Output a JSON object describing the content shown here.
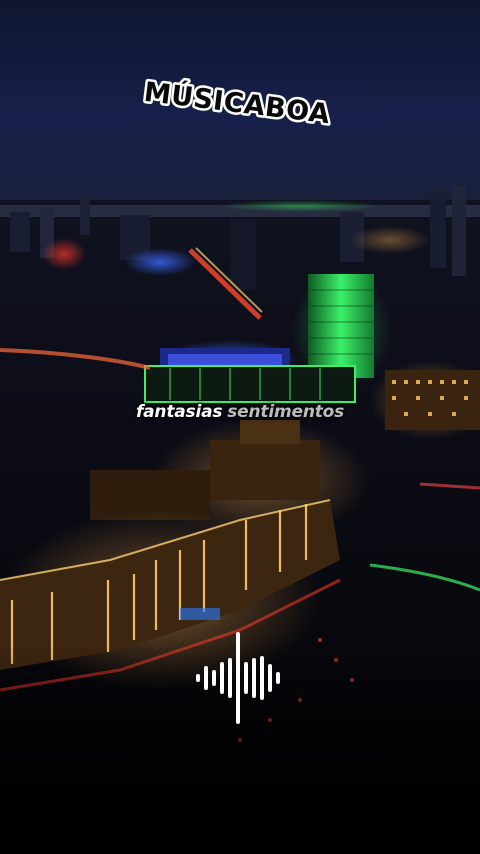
{
  "brand": {
    "name": "MÚSICABOA"
  },
  "lyrics": {
    "current_words": [
      "fantasias",
      "sentimentos"
    ]
  },
  "colors": {
    "sky_top": "#141b3a",
    "city_glow": "#ffb04a",
    "tower_green": "#36e25a",
    "blue_accent": "#3c4cff",
    "text_white": "#ffffff"
  },
  "icons": {
    "waveform": "audio-waveform-icon"
  }
}
